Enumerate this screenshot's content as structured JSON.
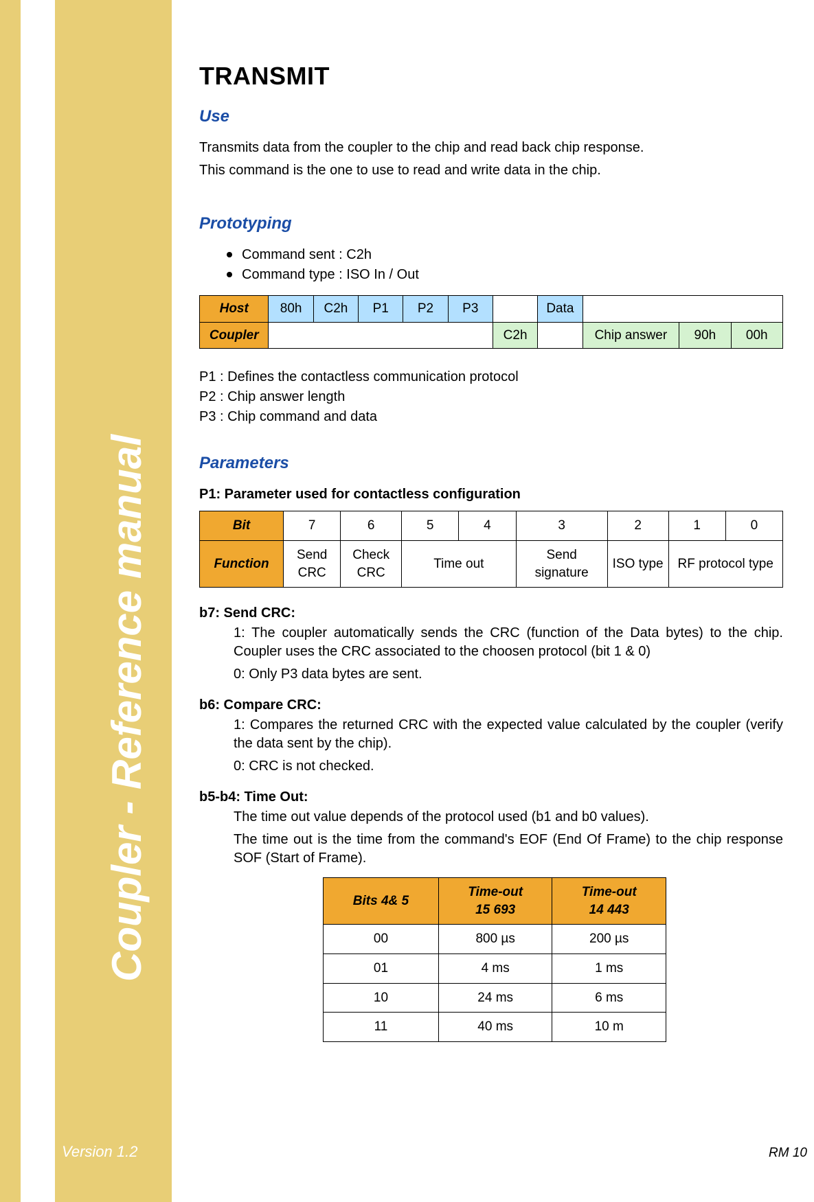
{
  "side_title": "Coupler - Reference manual",
  "version": "Version 1.2",
  "page_ref": "RM 10",
  "title": "TRANSMIT",
  "use": {
    "heading": "Use",
    "line1": "Transmits data from the coupler to the chip and read back chip response.",
    "line2": "This command is the one to use to read and write data in the chip."
  },
  "proto": {
    "heading": "Prototyping",
    "bullet1": "Command sent : C2h",
    "bullet2": "Command type : ISO In / Out",
    "host_label": "Host",
    "coupler_label": "Coupler",
    "host_cells": {
      "c1": "80h",
      "c2": "C2h",
      "c3": "P1",
      "c4": "P2",
      "c5": "P3",
      "c7": "Data"
    },
    "coupler_cells": {
      "c6": "C2h",
      "c8": "Chip answer",
      "c9": "90h",
      "c10": "00h"
    },
    "p1": "P1 : Defines the contactless communication protocol",
    "p2": "P2 : Chip answer length",
    "p3": "P3 : Chip command and data"
  },
  "params": {
    "heading": "Parameters",
    "p1_title": "P1: Parameter used for contactless configuration",
    "bit_label": "Bit",
    "func_label": "Function",
    "bits": {
      "b7": "7",
      "b6": "6",
      "b5": "5",
      "b4": "4",
      "b3": "3",
      "b2": "2",
      "b1": "1",
      "b0": "0"
    },
    "funcs": {
      "f7": "Send CRC",
      "f6": "Check CRC",
      "f54": "Time out",
      "f3": "Send signature",
      "f2": "ISO type",
      "f10": "RF protocol type"
    }
  },
  "b7": {
    "title": "b7: Send CRC:",
    "l1": "1: The coupler automatically sends the CRC (function of the Data bytes) to the chip. Coupler uses the CRC associated to the choosen protocol (bit 1 & 0)",
    "l2": "0: Only P3 data bytes are sent."
  },
  "b6": {
    "title": "b6: Compare CRC:",
    "l1": "1: Compares the returned CRC with the expected value calculated by the coupler (verify the data sent by the chip).",
    "l2": "0: CRC is not checked."
  },
  "b54": {
    "title": "b5-b4: Time Out:",
    "l1": "The time out value depends of the protocol used (b1 and b0 values).",
    "l2": "The time out is the time from the command's EOF (End Of Frame) to the chip response SOF (Start of Frame)."
  },
  "timeout_table": {
    "h1": "Bits 4& 5",
    "h2a": "Time-out",
    "h2b": "15 693",
    "h3a": "Time-out",
    "h3b": "14 443",
    "rows": [
      {
        "bits": "00",
        "t1": "800 µs",
        "t2": "200 µs"
      },
      {
        "bits": "01",
        "t1": "4 ms",
        "t2": "1 ms"
      },
      {
        "bits": "10",
        "t1": "24 ms",
        "t2": "6 ms"
      },
      {
        "bits": "11",
        "t1": "40 ms",
        "t2": "10 m"
      }
    ]
  }
}
